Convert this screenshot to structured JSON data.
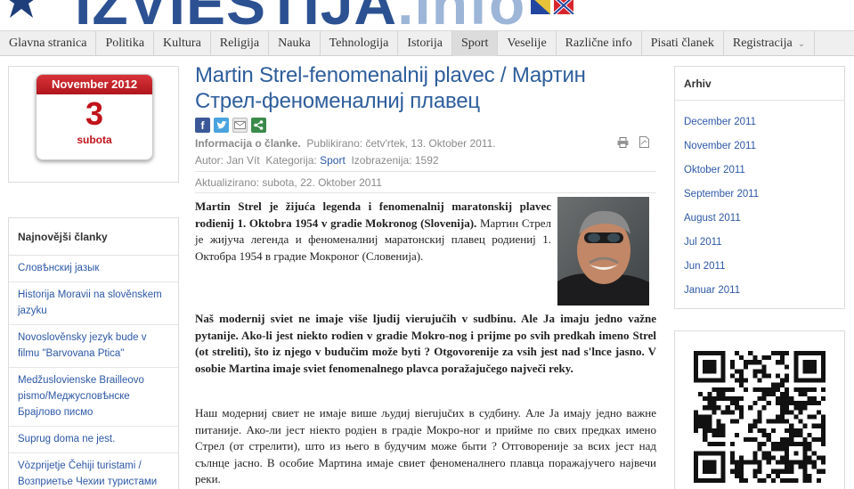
{
  "header": {
    "logo_text": "IZVIESTIJA",
    "logo_tld": ".info"
  },
  "nav": {
    "items": [
      {
        "label": "Glavna stranica"
      },
      {
        "label": "Politika"
      },
      {
        "label": "Kultura"
      },
      {
        "label": "Religija"
      },
      {
        "label": "Nauka"
      },
      {
        "label": "Tehnologija"
      },
      {
        "label": "Istorija"
      },
      {
        "label": "Sport",
        "active": true
      },
      {
        "label": "Veselije"
      },
      {
        "label": "Različne info"
      },
      {
        "label": "Pisati članek"
      },
      {
        "label": "Registracija"
      }
    ]
  },
  "calendar": {
    "month_year": "November 2012",
    "day": "3",
    "weekday": "subota"
  },
  "latest": {
    "title": "Najnovějši članky",
    "items": [
      "Словѣнскиј јазык",
      "Historija Moravii na slověnskem jazyku",
      "Novoslověnsky jezyk bude v filmu \"Barvovana Ptica\"",
      "Medžuslovienske Brailleovo pismo/Меджусловѣнске Брајлово писмо",
      "Suprug doma ne jest.",
      "Vòzpriјetјe Čehiji turistami / Возприетье Чехии туристами"
    ]
  },
  "article": {
    "title": "Martin Strel-fenomenalnij plavec / Мартин Стрел-феноменалниј плавец",
    "info_label": "Informacija o članke.",
    "published_label": "Publikirano:",
    "published_value": "četv'rtek, 13. Oktober 2011.",
    "author_label": "Autor:",
    "author_value": "Jan Vít",
    "category_label": "Kategorija:",
    "category_value": "Sport",
    "views_label": "Izobrazenija:",
    "views_value": "1592",
    "updated": "Aktualizirano: subota, 22. Oktober 2011",
    "p1_bold": "Martin Strel je žijuća legenda i  fenomenalnij maratonskij plavec  rodienij 1.  Oktobra 1954 v gradie Mokronog (Slovenija).",
    "p1_rest": " Мартин Стрел је жијуча легенда и  феноменалниј маратонскиј  плавец  родиениј 1. Октобра 1954 в градие Мокроног (Словенија).",
    "p2": "Naš modernij sviet ne imaje više ljudij vierujučih v sudbinu. Ale Ja imaju jedno važne pytanije. Ako-li jest niekto rodien v gradie Mokro-nog  i  prijme po svih predkah imeno Strel (ot streliti), što iz njego v budučim može byti ? Otgovorenije za vsih jest nad s'lnce jasno. V osobie Martina imaje sviet fenomenalnego plavca poražajučego največi reky.",
    "p3": "Наш модерниј свиет не имаје више људиј вierujučих в судбину. Але  Ја имају једно важне питаније. Ако-ли јест ніекто родіен в градіе Мокро-ног  и  прийме по свих предках имено Стрел (от стрелити), што из њего в будучим може быти ? Отговореније за всих јест над сълнце јасно. В особие Мартина имаје свиет феноменалнего плавца поражајучего највечи реки."
  },
  "archive": {
    "title": "Arhiv",
    "items": [
      "December 2011",
      "November 2011",
      "Oktober 2011",
      "September 2011",
      "August 2011",
      "Jul 2011",
      "Jun 2011",
      "Januar 2011"
    ]
  },
  "colors": {
    "title_blue": "#2e5e9c",
    "link_blue": "#2d58a6",
    "calendar_red": "#c1121a"
  }
}
